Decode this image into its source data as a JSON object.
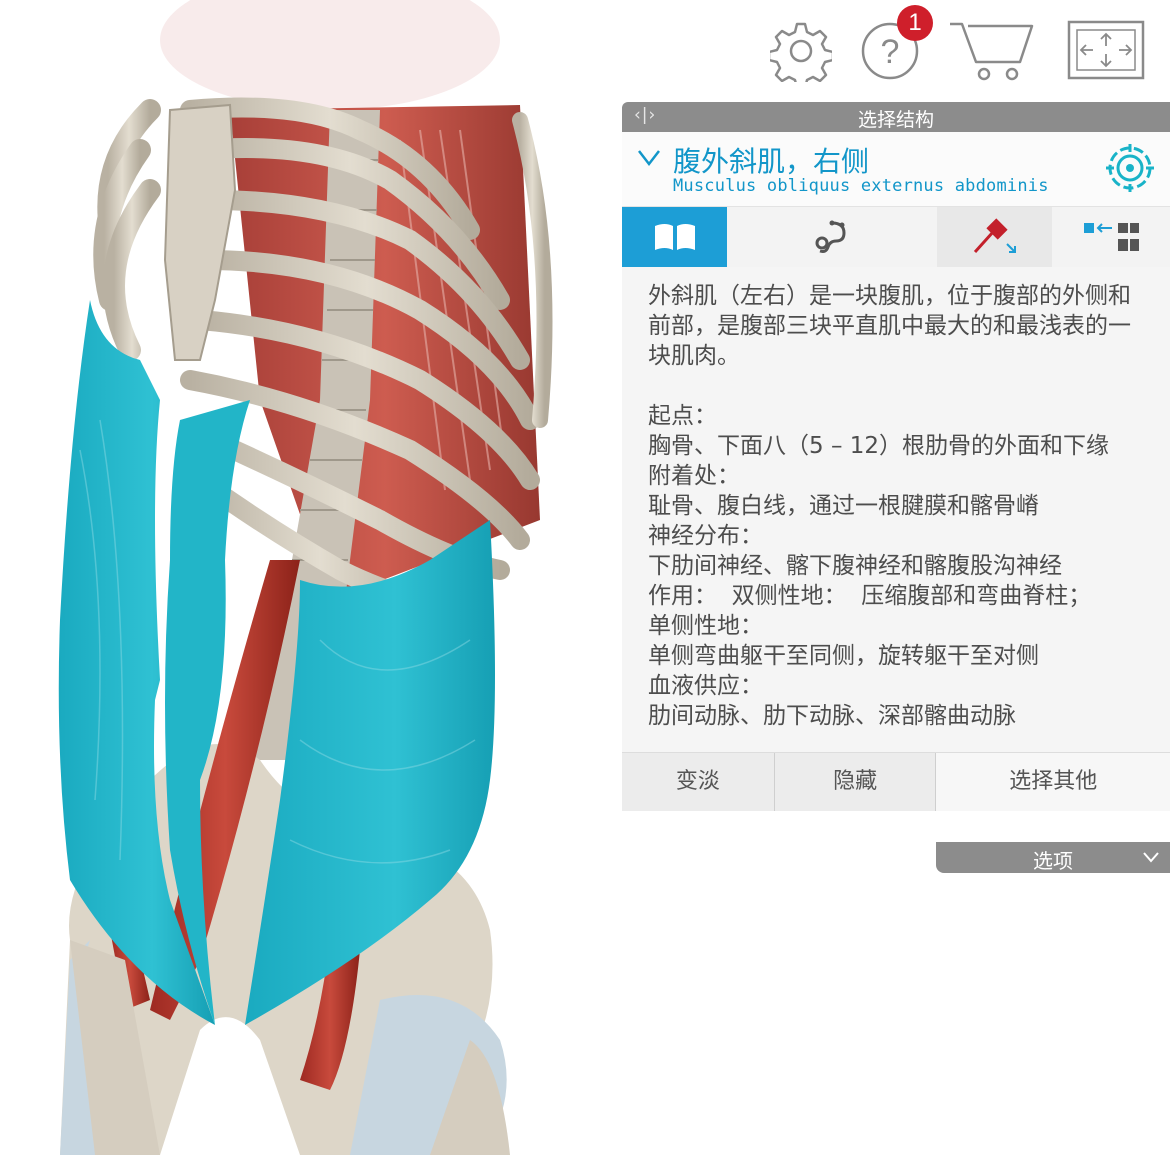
{
  "toolbar": {
    "help_badge_count": "1",
    "icons": [
      "gear-icon",
      "help-icon",
      "cart-icon",
      "fullscreen-icon"
    ]
  },
  "panel": {
    "header_title": "选择结构",
    "header_arrows": "‹|›",
    "structure_name_cn": "腹外斜肌，右侧",
    "structure_name_la": "Musculus obliquus externus abdominis",
    "tabs": [
      "book-icon",
      "stethoscope-icon",
      "pin-icon",
      "layers-icon"
    ],
    "description": {
      "intro": "外斜肌（左右）是一块腹肌，位于腹部的外侧和前部，是腹部三块平直肌中最大的和最浅表的一块肌肉。",
      "origin_label": "起点：",
      "origin_value": "胸骨、下面八（5 – 12）根肋骨的外面和下缘",
      "insertion_label": "附着处：",
      "insertion_value": "耻骨、腹白线，通过一根腱膜和髂骨嵴",
      "nerve_label": "神经分布：",
      "nerve_value": "下肋间神经、髂下腹神经和髂腹股沟神经",
      "action_line": "作用：  双侧性地：  压缩腹部和弯曲脊柱；",
      "unilateral_label": "单侧性地：",
      "unilateral_value": "单侧弯曲躯干至同侧，旋转躯干至对侧",
      "blood_label": "血液供应：",
      "blood_value": "肋间动脉、肋下动脉、深部髂曲动脉"
    },
    "actions": {
      "fade": "变淡",
      "hide": "隐藏",
      "select_other": "选择其他"
    },
    "options_label": "选项"
  },
  "colors": {
    "accent": "#1d9ed6",
    "selected_muscle": "#1fb4c8",
    "header_gray": "#8c8c8c",
    "badge": "#cf1f2b"
  }
}
